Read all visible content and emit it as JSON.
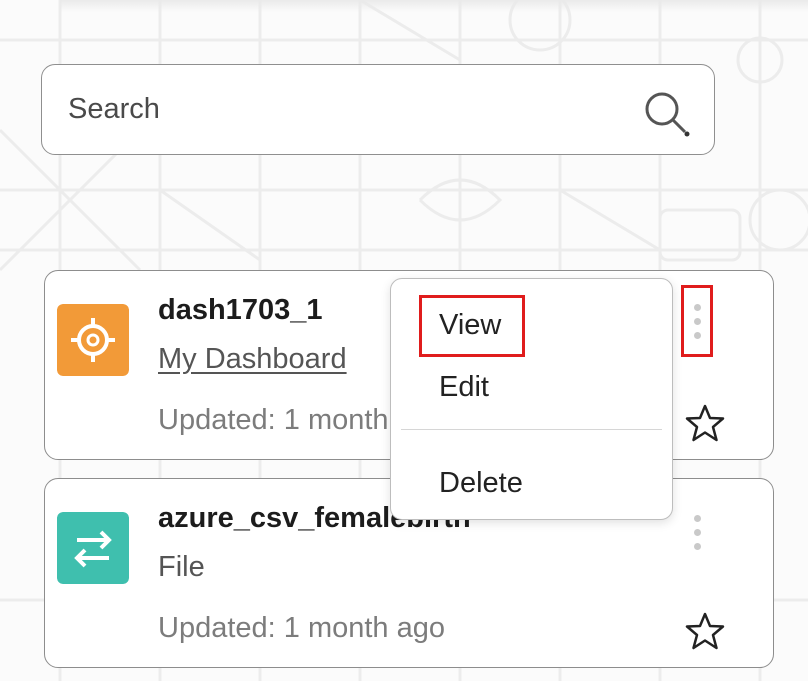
{
  "search": {
    "placeholder": "Search",
    "icon": "search-icon"
  },
  "cards": [
    {
      "title": "dash1703_1",
      "subtitle": "My Dashboard",
      "updated": "Updated: 1 month ago",
      "icon": "dashboard-icon",
      "icon_color": "#f29a38"
    },
    {
      "title": "azure_csv_femalebirth",
      "subtitle": "File",
      "updated": "Updated: 1 month ago",
      "icon": "transfer-arrows-icon",
      "icon_color": "#3fbfae"
    }
  ],
  "context_menu": {
    "items": [
      "View",
      "Edit",
      "Delete"
    ]
  },
  "highlight_color": "#e01c1c"
}
